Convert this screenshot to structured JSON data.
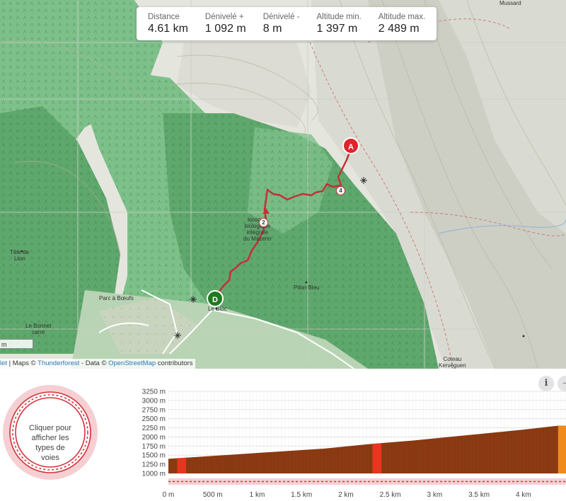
{
  "stats": [
    {
      "label": "Distance",
      "value": "4.61 km"
    },
    {
      "label": "Dénivelé +",
      "value": "1 092 m"
    },
    {
      "label": "Dénivelé -",
      "value": "8 m"
    },
    {
      "label": "Altitude min.",
      "value": "1 397 m"
    },
    {
      "label": "Altitude max.",
      "value": "2 489 m"
    }
  ],
  "map": {
    "places": [
      {
        "name": "Mussard"
      },
      {
        "name": "Tête de\nLion"
      },
      {
        "name": "Parc à Bœufs"
      },
      {
        "name": "Le Bonnet\ncarré"
      },
      {
        "name": "Piton Bleu"
      },
      {
        "name": "Le Bloc"
      },
      {
        "name": "Coteau\nKervéguen"
      },
      {
        "name": "kiosque\nbiologique\nintégrale\ndu Mazerin"
      }
    ],
    "scale_label": "m",
    "markers": {
      "start": "A",
      "end": "D"
    },
    "km_markers": [
      "4",
      "2"
    ],
    "attribution": {
      "prefix": "let",
      "sep1": " | Maps © ",
      "thunderforest": "Thunderforest",
      "sep2": " - Data © ",
      "osm": "OpenStreetMap",
      "suffix": " contributors"
    }
  },
  "road_types": {
    "label": "Cliquer pour afficher les types de voies"
  },
  "buttons": {
    "info": "i",
    "minus": "−"
  },
  "chart_data": {
    "type": "area",
    "title": "",
    "xlabel": "",
    "ylabel": "",
    "x_ticks": [
      "0 m",
      "500 m",
      "1 km",
      "1.5 km",
      "2 km",
      "2.5 km",
      "3 km",
      "3.5 km",
      "4 km"
    ],
    "x_tick_values": [
      0,
      0.5,
      1,
      1.5,
      2,
      2.5,
      3,
      3.5,
      4
    ],
    "y_ticks": [
      "1000 m",
      "1250 m",
      "1500 m",
      "1750 m",
      "2000 m",
      "2250 m",
      "2500 m",
      "2750 m",
      "3000 m",
      "3250 m"
    ],
    "y_tick_values": [
      1000,
      1250,
      1500,
      1750,
      2000,
      2250,
      2500,
      2750,
      3000,
      3250
    ],
    "xlim": [
      0,
      4.61
    ],
    "ylim": [
      1000,
      3250
    ],
    "x": [
      0,
      0.25,
      0.5,
      0.75,
      1,
      1.25,
      1.5,
      1.75,
      2,
      2.25,
      2.5,
      2.75,
      3,
      3.25,
      3.5,
      3.75,
      4,
      4.25,
      4.4
    ],
    "y": [
      1400,
      1440,
      1480,
      1520,
      1560,
      1600,
      1640,
      1680,
      1740,
      1800,
      1850,
      1900,
      1960,
      2020,
      2080,
      2140,
      2200,
      2270,
      2310
    ],
    "series_color": "#8b3a12",
    "highlight_segments": [
      {
        "from": 0.1,
        "to": 0.2,
        "color": "#e8351f"
      },
      {
        "from": 2.3,
        "to": 2.4,
        "color": "#e8351f"
      },
      {
        "from": 4.39,
        "to": 4.61,
        "color": "#f08a1a"
      }
    ]
  }
}
